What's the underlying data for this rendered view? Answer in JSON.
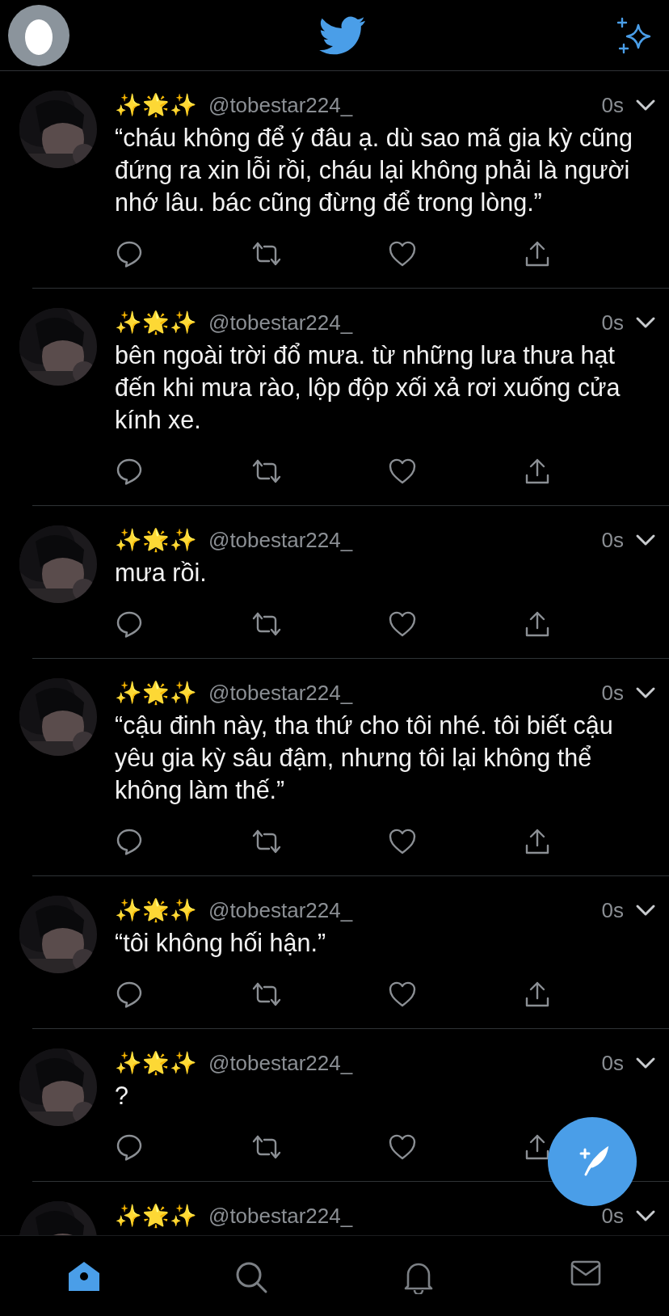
{
  "tweets": [
    {
      "display_name": "✨🌟✨",
      "handle": "@tobestar224_",
      "time": "0s",
      "text": "“cháu không để ý đâu ạ. dù sao mã gia kỳ cũng đứng ra xin lỗi rồi, cháu lại không phải là người nhớ lâu. bác cũng đừng để trong lòng.”"
    },
    {
      "display_name": "✨🌟✨",
      "handle": "@tobestar224_",
      "time": "0s",
      "text": "bên ngoài trời đổ mưa. từ những lưa thưa hạt đến khi mưa rào, lộp độp xối xả rơi xuống cửa kính xe."
    },
    {
      "display_name": "✨🌟✨",
      "handle": "@tobestar224_",
      "time": "0s",
      "text": "mưa rồi."
    },
    {
      "display_name": "✨🌟✨",
      "handle": "@tobestar224_",
      "time": "0s",
      "text": "“cậu đinh này, tha thứ cho tôi nhé. tôi biết cậu yêu gia kỳ sâu đậm, nhưng tôi lại không thể không làm thế.”"
    },
    {
      "display_name": "✨🌟✨",
      "handle": "@tobestar224_",
      "time": "0s",
      "text": "“tôi không hối hận.”"
    },
    {
      "display_name": "✨🌟✨",
      "handle": "@tobestar224_",
      "time": "0s",
      "text": "?"
    },
    {
      "display_name": "✨🌟✨",
      "handle": "@tobestar224_",
      "time": "0s"
    }
  ],
  "tabs": [
    {
      "kind": "home",
      "selected": true
    },
    {
      "kind": "search",
      "selected": false
    },
    {
      "kind": "notifications",
      "selected": false
    },
    {
      "kind": "messages",
      "selected": false
    }
  ]
}
